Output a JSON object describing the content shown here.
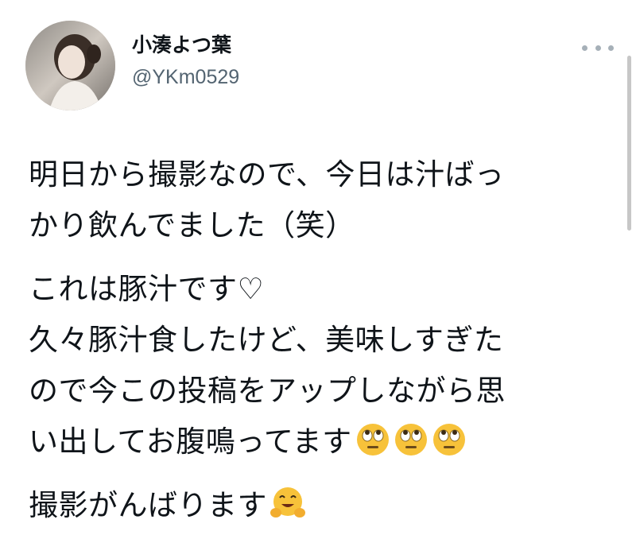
{
  "author": {
    "display_name": "小湊よつ葉",
    "handle": "@YKm0529"
  },
  "tweet": {
    "p1": [
      "明日から撮影なので、今日は汁ばっ",
      "かり飲んでました（笑）"
    ],
    "p2": [
      "これは豚汁です♡",
      "久々豚汁食したけど、美味しすぎた",
      "ので今この投稿をアップしながら思",
      "い出してお腹鳴ってます"
    ],
    "p3": [
      "撮影がんばります"
    ]
  },
  "icons": {
    "emoji_eyeroll": "face-with-rolling-eyes-emoji",
    "emoji_hug": "hugging-face-emoji",
    "more": "more-options-icon"
  },
  "colors": {
    "text": "#0f1419",
    "secondary": "#536471",
    "dots": "#a6b0b8",
    "emoji_yellow": "#f7c23a"
  }
}
